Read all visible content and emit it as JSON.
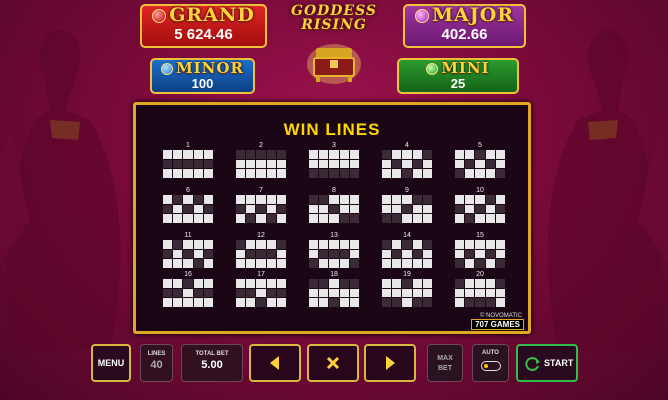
{
  "jackpots": {
    "grand": {
      "name": "GRAND",
      "value": "5 624.46"
    },
    "major": {
      "name": "MAJOR",
      "value": "402.66"
    },
    "minor": {
      "name": "MINOR",
      "value": "100"
    },
    "mini": {
      "name": "MINI",
      "value": "25"
    }
  },
  "logo": {
    "line1": "GODDESS",
    "line2": "RISING"
  },
  "panel": {
    "title": "WIN LINES",
    "copyright": "© NOVOMATIC",
    "brand": "707 GAMES"
  },
  "lines": [
    {
      "n": "1",
      "p": [
        1,
        1,
        1,
        1,
        1
      ]
    },
    {
      "n": "2",
      "p": [
        0,
        0,
        0,
        0,
        0
      ]
    },
    {
      "n": "3",
      "p": [
        2,
        2,
        2,
        2,
        2
      ]
    },
    {
      "n": "4",
      "p": [
        0,
        1,
        2,
        1,
        0
      ]
    },
    {
      "n": "5",
      "p": [
        2,
        1,
        0,
        1,
        2
      ]
    },
    {
      "n": "6",
      "p": [
        1,
        0,
        1,
        0,
        1
      ]
    },
    {
      "n": "7",
      "p": [
        1,
        2,
        1,
        2,
        1
      ]
    },
    {
      "n": "8",
      "p": [
        0,
        0,
        1,
        2,
        2
      ]
    },
    {
      "n": "9",
      "p": [
        2,
        2,
        1,
        0,
        0
      ]
    },
    {
      "n": "10",
      "p": [
        1,
        2,
        1,
        0,
        1
      ]
    },
    {
      "n": "11",
      "p": [
        1,
        0,
        1,
        2,
        1
      ]
    },
    {
      "n": "12",
      "p": [
        0,
        1,
        1,
        1,
        0
      ]
    },
    {
      "n": "13",
      "p": [
        2,
        1,
        1,
        1,
        2
      ]
    },
    {
      "n": "14",
      "p": [
        0,
        1,
        0,
        1,
        0
      ]
    },
    {
      "n": "15",
      "p": [
        2,
        1,
        2,
        1,
        2
      ]
    },
    {
      "n": "16",
      "p": [
        1,
        1,
        0,
        1,
        1
      ]
    },
    {
      "n": "17",
      "p": [
        1,
        1,
        2,
        1,
        1
      ]
    },
    {
      "n": "18",
      "p": [
        0,
        0,
        2,
        0,
        0
      ]
    },
    {
      "n": "19",
      "p": [
        2,
        2,
        0,
        2,
        2
      ]
    },
    {
      "n": "20",
      "p": [
        0,
        2,
        2,
        2,
        0
      ]
    }
  ],
  "controls": {
    "menu": "MENU",
    "lines_label": "LINES",
    "lines_value": "40",
    "total_bet_label": "TOTAL BET",
    "total_bet_value": "5.00",
    "max_bet_line1": "MAX",
    "max_bet_line2": "BET",
    "auto": "AUTO",
    "start": "START"
  },
  "icons": {
    "prev": "left-arrow-icon",
    "close": "close-icon",
    "next": "right-arrow-icon",
    "start": "spin-icon"
  },
  "colors": {
    "accent": "#e0a720",
    "start": "#2fbf4a",
    "title": "#ffd700"
  }
}
